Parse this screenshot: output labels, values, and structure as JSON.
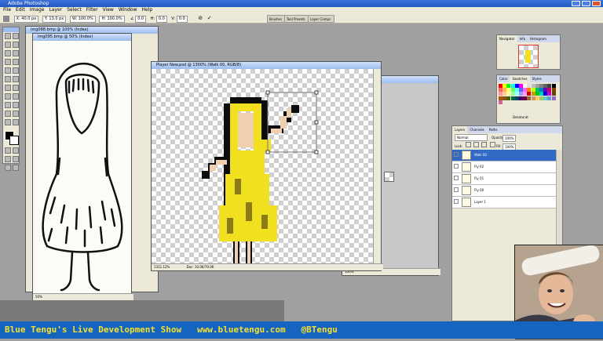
{
  "app": {
    "title": "Adobe Photoshop"
  },
  "menu": [
    "File",
    "Edit",
    "Image",
    "Layer",
    "Select",
    "Filter",
    "View",
    "Window",
    "Help"
  ],
  "options": {
    "x": "X: 40.0 px",
    "y": "Y: 13.0 px",
    "w": "W: 100.0%",
    "h": "H: 100.0%",
    "angle": "0.0",
    "hskew": "0.0",
    "vskew": "0.0",
    "wells": [
      "Brushes",
      "Tool Presets",
      "Layer Comps"
    ]
  },
  "docs": {
    "doc1_title": "img088.bmp @ 100% (Index)",
    "doc2_title": "img095.bmp @ 50% (Index)",
    "doc2_zoom": "50%",
    "main_title": "Player New.psd @ 1300% (Walk 00, RGB/8)",
    "main_zoom": "1311.12%",
    "main_docsize": "Doc: 10.0K/79.0K",
    "bg_title": "0% (Player ...",
    "bg_zoom": "100%"
  },
  "navigator": {
    "tabs": [
      "Navigator",
      "Info",
      "Histogram"
    ]
  },
  "swatches": {
    "tabs": [
      "Color",
      "Swatches",
      "Styles"
    ],
    "caption": "Desaturat",
    "colors": [
      "#ff0000",
      "#ffff00",
      "#00ff00",
      "#00ffff",
      "#0000ff",
      "#ff00ff",
      "#ffffff",
      "#e0e0e0",
      "#c0c0c0",
      "#a0a0a0",
      "#808080",
      "#606060",
      "#404040",
      "#000000",
      "#ff6060",
      "#ffb060",
      "#ffff60",
      "#60ff60",
      "#60ffff",
      "#6060ff",
      "#ff60ff",
      "#ff8000",
      "#c0ff00",
      "#00c060",
      "#0080c0",
      "#6000c0",
      "#c00060",
      "#804000",
      "#ff9999",
      "#ffcc99",
      "#ffff99",
      "#99ff99",
      "#99ffff",
      "#9999ff",
      "#ff99ff",
      "#cc0000",
      "#cc9900",
      "#00cc00",
      "#00cccc",
      "#0000cc",
      "#cc00cc",
      "#664400",
      "#aa5500",
      "#885522",
      "#446600",
      "#006644",
      "#004466",
      "#440066",
      "#660044",
      "#996633",
      "#cc9966",
      "#ffcc66",
      "#99cc66",
      "#66cccc",
      "#6699cc",
      "#9966cc",
      "#cc6699"
    ]
  },
  "layers": {
    "tabs": [
      "Layers",
      "Channels",
      "Paths"
    ],
    "blend": "Normal",
    "opacity_label": "Opacity:",
    "opacity": "100%",
    "lock_label": "Lock:",
    "fill_label": "Fill:",
    "fill": "100%",
    "rows": [
      "Walk 00",
      "Fly 02",
      "Fly 01",
      "Fly 00",
      "Layer 1"
    ]
  },
  "banner": {
    "text": "Blue Tengu's Live Development Show   www.bluetengu.com   @BTengu"
  },
  "colors": {
    "accent": "#316ac5",
    "banner_bg": "#1565c0",
    "banner_text": "#f5e030"
  }
}
